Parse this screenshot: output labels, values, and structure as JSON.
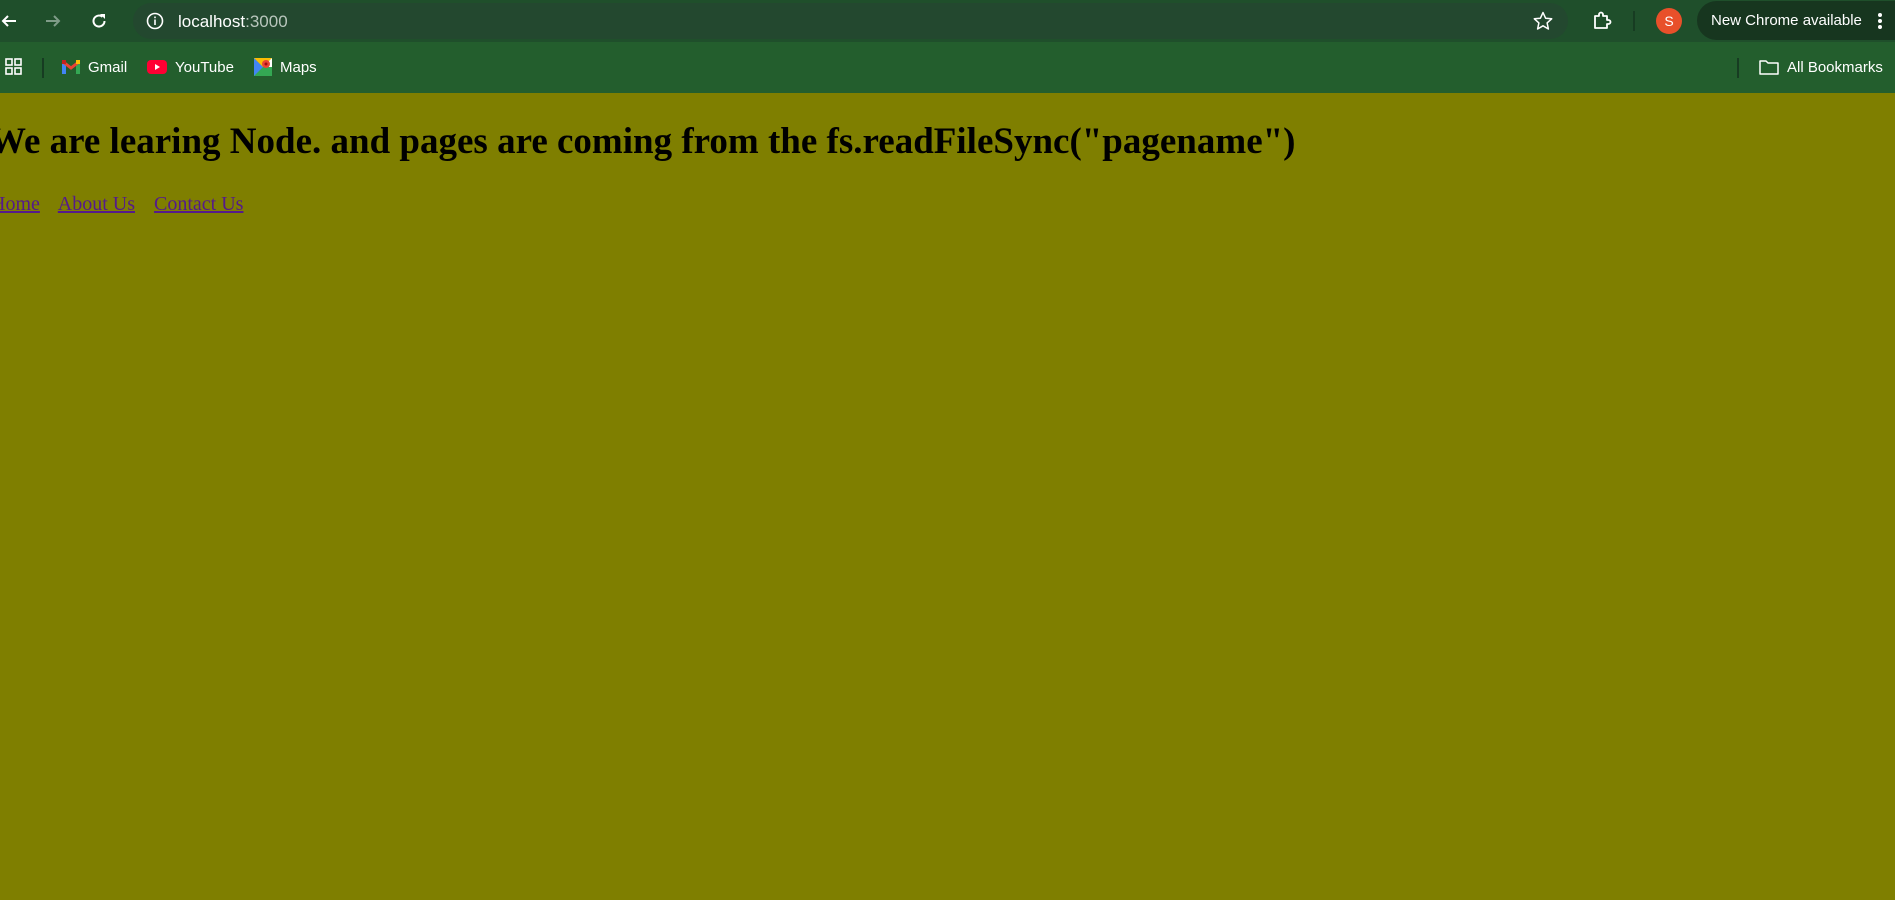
{
  "browser": {
    "url_host": "localhost",
    "url_port": ":3000",
    "profile_initial": "S",
    "update_label": "New Chrome available",
    "icons": [
      "back-icon",
      "forward-icon",
      "reload-icon",
      "site-info-icon",
      "star-icon",
      "extensions-icon",
      "more-icon"
    ]
  },
  "bookmarks": {
    "items": [
      {
        "label": "Gmail",
        "icon": "gmail-icon"
      },
      {
        "label": "YouTube",
        "icon": "youtube-icon"
      },
      {
        "label": "Maps",
        "icon": "maps-icon"
      }
    ],
    "all_label": "All Bookmarks"
  },
  "page": {
    "heading": "We are learing Node. and pages are coming from the fs.readFileSync(\"pagename\")",
    "links": [
      "Home",
      "About Us",
      "Contact Us"
    ],
    "background": "#7f7f00",
    "link_color": "#551a8b"
  }
}
